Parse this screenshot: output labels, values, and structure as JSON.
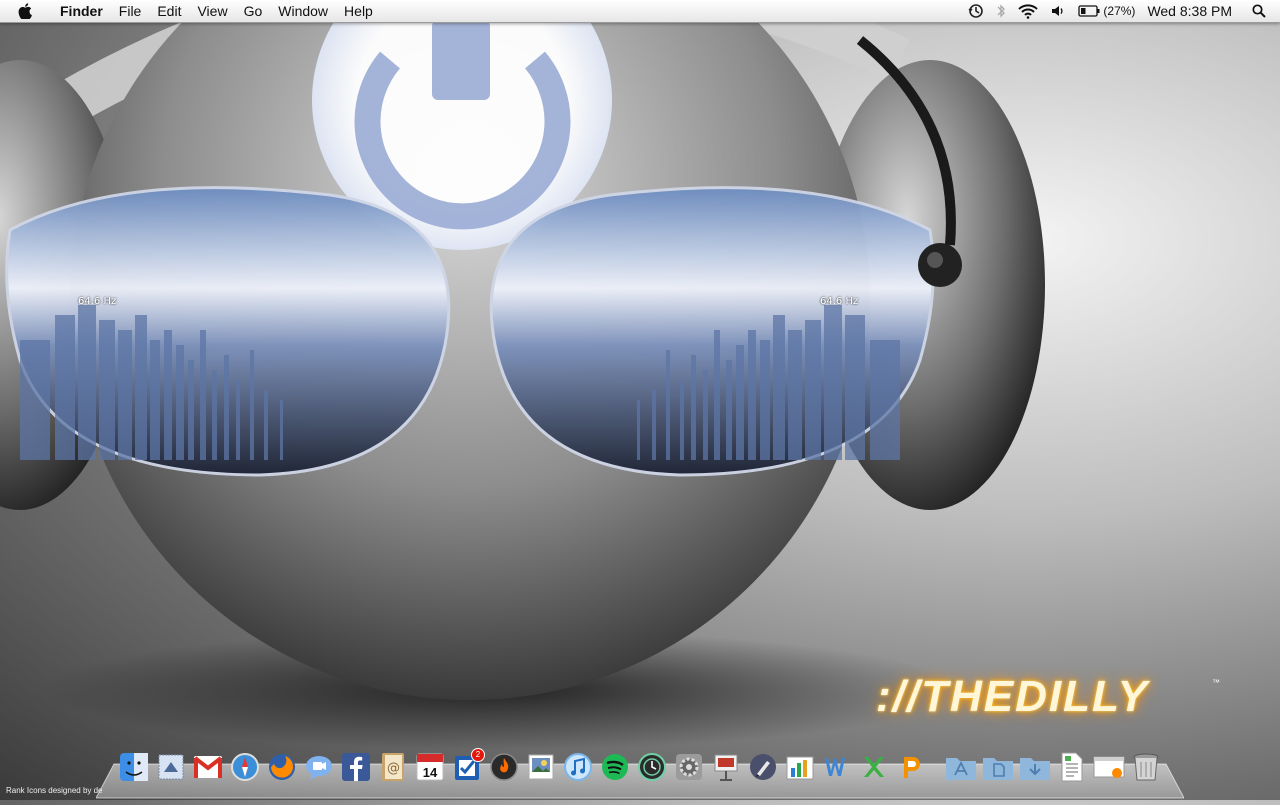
{
  "menubar": {
    "app_name": "Finder",
    "menus": [
      "File",
      "Edit",
      "View",
      "Go",
      "Window",
      "Help"
    ],
    "status": {
      "battery_percent": "(27%)",
      "clock": "Wed 8:38 PM"
    },
    "icons": [
      "apple-icon",
      "time-machine-icon",
      "bluetooth-icon",
      "wifi-icon",
      "volume-icon",
      "battery-icon",
      "spotlight-icon"
    ]
  },
  "wallpaper": {
    "brand": "://THEDILLY",
    "brand_tm": "™",
    "frequency_label_left": "64.6 Hz",
    "frequency_label_right": "64.6 Hz"
  },
  "dock": {
    "credit": "Rank Icons designed by de",
    "calendar_day": "14",
    "reminder_badge": "2",
    "apps": [
      "finder",
      "mail-stamp",
      "gmail",
      "safari",
      "firefox",
      "ichat",
      "facebook",
      "address-book",
      "ical",
      "todo",
      "burn",
      "photo",
      "itunes",
      "spotify",
      "time-machine",
      "system-preferences",
      "keynote",
      "pen-tool",
      "numbers",
      "word",
      "excel",
      "powerpoint",
      "applications-folder",
      "documents-folder",
      "downloads-folder",
      "text-file",
      "browser-window",
      "trash"
    ],
    "colors": {
      "accent_orange": "#ff8a00",
      "facebook_blue": "#3b5998",
      "gmail_red": "#d93025",
      "spotify_green": "#1db954"
    }
  }
}
